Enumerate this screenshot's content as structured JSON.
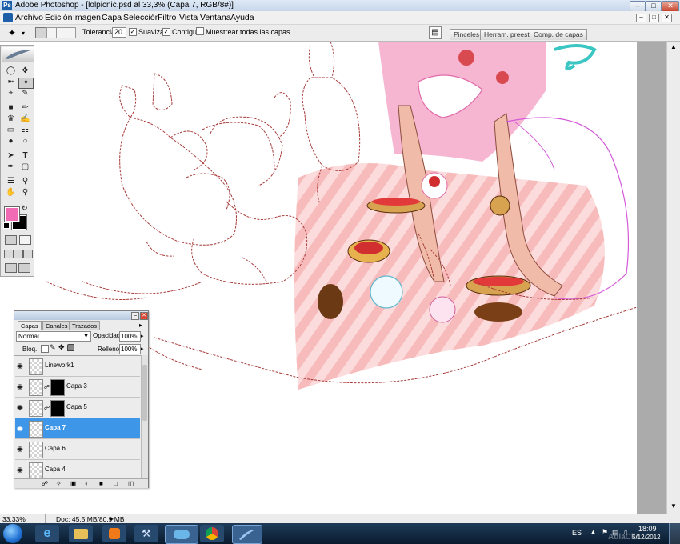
{
  "window": {
    "title": "Adobe Photoshop - [lolpicnic.psd al 33,3% (Capa 7, RGB/8#)]",
    "app_icon": "Ps"
  },
  "menu": [
    "Archivo",
    "Edición",
    "Imagen",
    "Capa",
    "Selección",
    "Filtro",
    "Vista",
    "Ventana",
    "Ayuda"
  ],
  "options": {
    "tolerance_label": "Tolerancia:",
    "tolerance_value": "20",
    "smooth_label": "Suavizar",
    "contiguous_label": "Contiguo",
    "all_layers_label": "Muestrear todas las capas",
    "smooth_checked": true,
    "contiguous_checked": true,
    "all_layers_checked": false
  },
  "palette_tabs": [
    "Pinceles",
    "Herram. preest.",
    "Comp. de capas"
  ],
  "colors": {
    "foreground": "#f06ab4",
    "background": "#000000",
    "selection": "#3d96e8",
    "sketch_line": "#a83a3a"
  },
  "layers_panel": {
    "tabs": [
      "Capas",
      "Canales",
      "Trazados"
    ],
    "blend_mode": "Normal",
    "opacity_label": "Opacidad:",
    "opacity_value": "100%",
    "lock_label": "Bloq.:",
    "fill_label": "Relleno:",
    "fill_value": "100%",
    "layers": [
      {
        "name": "Linework1",
        "has_mask": false,
        "selected": false
      },
      {
        "name": "Capa 3",
        "has_mask": true,
        "selected": false
      },
      {
        "name": "Capa 5",
        "has_mask": true,
        "selected": false
      },
      {
        "name": "Capa 7",
        "has_mask": false,
        "selected": true
      },
      {
        "name": "Capa 6",
        "has_mask": false,
        "selected": false
      },
      {
        "name": "Capa 4",
        "has_mask": false,
        "selected": false
      }
    ]
  },
  "status": {
    "zoom": "33,33%",
    "doc": "Doc: 45,5 MB/80,9 MB"
  },
  "taskbar": {
    "lang": "ES",
    "time": "18:09",
    "date": "5/12/2012",
    "watermark": "AulaClic"
  }
}
